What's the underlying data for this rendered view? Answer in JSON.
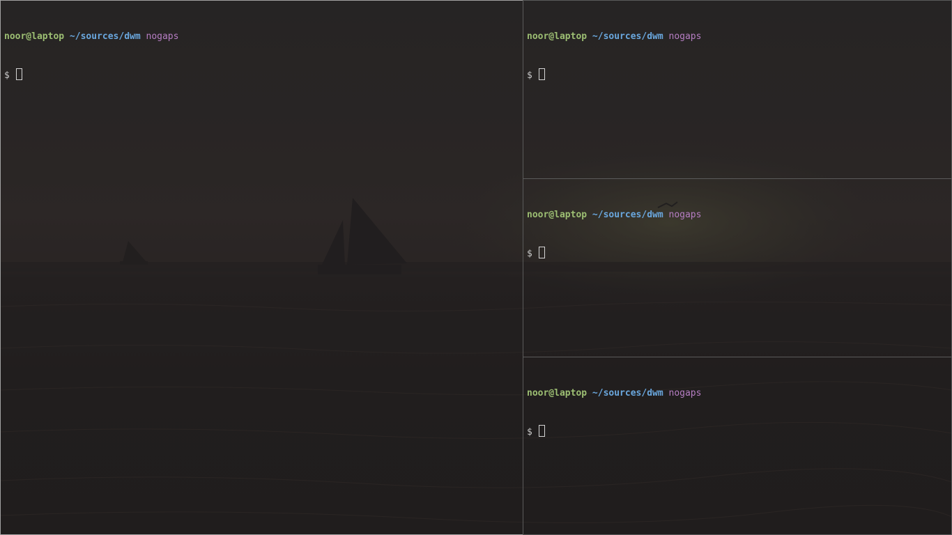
{
  "terminals": [
    {
      "user_host": "noor@laptop",
      "cwd": "~/sources/dwm",
      "branch": "nogaps",
      "prompt_symbol": "$"
    },
    {
      "user_host": "noor@laptop",
      "cwd": "~/sources/dwm",
      "branch": "nogaps",
      "prompt_symbol": "$"
    },
    {
      "user_host": "noor@laptop",
      "cwd": "~/sources/dwm",
      "branch": "nogaps",
      "prompt_symbol": "$"
    },
    {
      "user_host": "noor@laptop",
      "cwd": "~/sources/dwm",
      "branch": "nogaps",
      "prompt_symbol": "$"
    }
  ],
  "colors": {
    "user_host": "#9dbf73",
    "cwd": "#6aa7de",
    "branch": "#b77ec4",
    "focused_border": "#a3a3a3",
    "unfocused_border": "#5b5b5b"
  },
  "wallpaper": {
    "subject": "sunset-sea-with-sailboats"
  }
}
